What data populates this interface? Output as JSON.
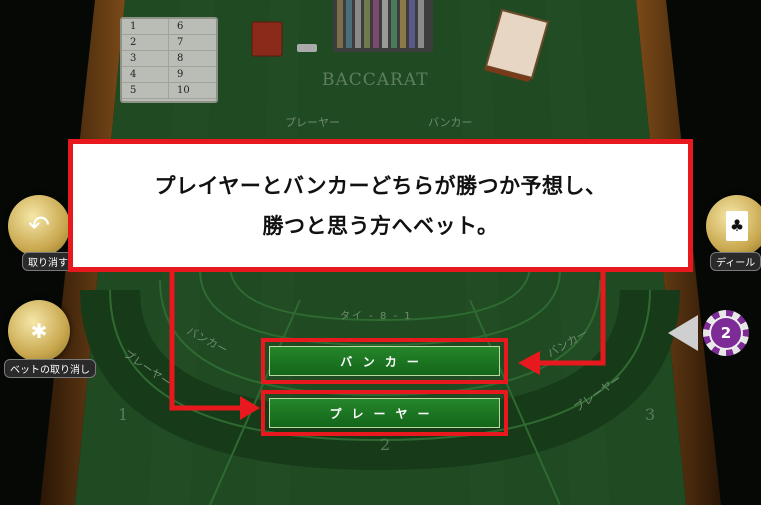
{
  "scoreboard": {
    "left_column": [
      "1",
      "2",
      "3",
      "4",
      "5"
    ],
    "right_column": [
      "6",
      "7",
      "8",
      "9",
      "10"
    ]
  },
  "table": {
    "logo": "BACCARAT",
    "player_header": "プレーヤー",
    "banker_header": "バンカー",
    "tie_label": "タイ - 8 - 1",
    "seat_numbers": [
      "1",
      "2",
      "3"
    ],
    "arc_player": "プレーヤー",
    "arc_banker": "バンカー"
  },
  "side_buttons": {
    "undo_label": "取り消す",
    "cancel_bets_label": "ベットの取り消し",
    "deal_label": "ディール"
  },
  "chip": {
    "value": "2"
  },
  "callout": {
    "line1": "プレイヤーとバンカーどちらが勝つか予想し、",
    "line2": "勝つと思う方へベット。"
  },
  "bets": {
    "banker": "バンカー",
    "player": "プレーヤー"
  },
  "colors": {
    "highlight_red": "#e8191e",
    "felt_green": "#1f4a22"
  }
}
